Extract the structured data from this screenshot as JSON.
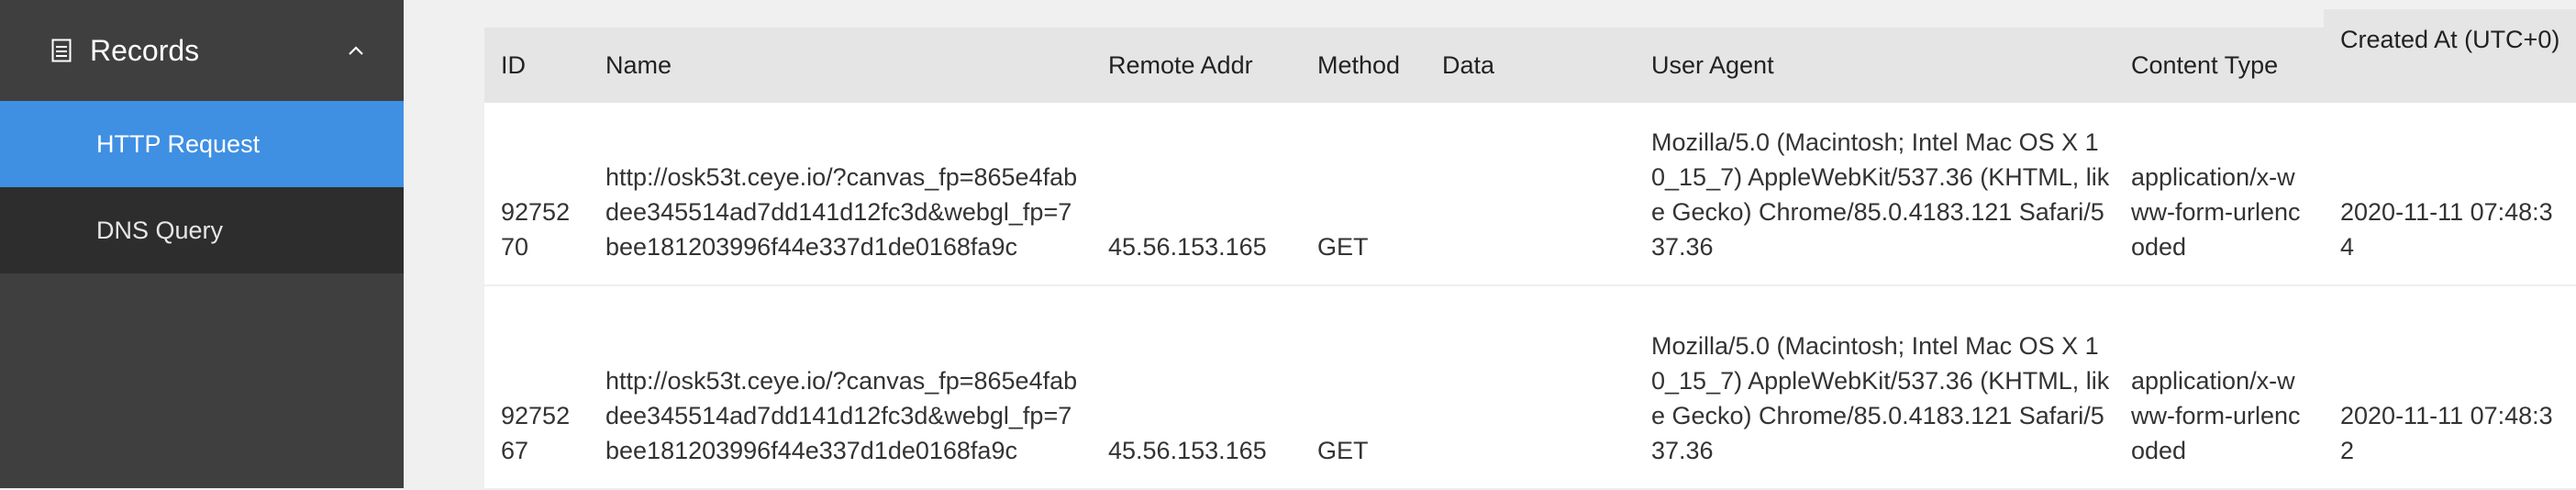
{
  "sidebar": {
    "section_label": "Records",
    "items": [
      {
        "label": "HTTP Request",
        "active": true
      },
      {
        "label": "DNS Query",
        "active": false
      }
    ],
    "colors": {
      "bg": "#3f3f3f",
      "active": "#3f8fe3",
      "inactive": "#2d2d2d"
    }
  },
  "table": {
    "columns": {
      "id": "ID",
      "name": "Name",
      "remote_addr": "Remote Addr",
      "method": "Method",
      "data": "Data",
      "user_agent": "User Agent",
      "content_type": "Content Type",
      "created_at": "Created At (UTC+0)"
    },
    "rows": [
      {
        "id": "9275270",
        "name": "http://osk53t.ceye.io/?canvas_fp=865e4fabdee345514ad7dd141d12fc3d&webgl_fp=7bee181203996f44e337d1de0168fa9c",
        "remote_addr": "45.56.153.165",
        "method": "GET",
        "data": "",
        "user_agent": "Mozilla/5.0 (Macintosh; Intel Mac OS X 10_15_7) AppleWebKit/537.36 (KHTML, like Gecko) Chrome/85.0.4183.121 Safari/537.36",
        "content_type": "application/x-www-form-urlencoded",
        "created_at": "2020-11-11 07:48:34"
      },
      {
        "id": "9275267",
        "name": "http://osk53t.ceye.io/?canvas_fp=865e4fabdee345514ad7dd141d12fc3d&webgl_fp=7bee181203996f44e337d1de0168fa9c",
        "remote_addr": "45.56.153.165",
        "method": "GET",
        "data": "",
        "user_agent": "Mozilla/5.0 (Macintosh; Intel Mac OS X 10_15_7) AppleWebKit/537.36 (KHTML, like Gecko) Chrome/85.0.4183.121 Safari/537.36",
        "content_type": "application/x-www-form-urlencoded",
        "created_at": "2020-11-11 07:48:32"
      }
    ]
  }
}
